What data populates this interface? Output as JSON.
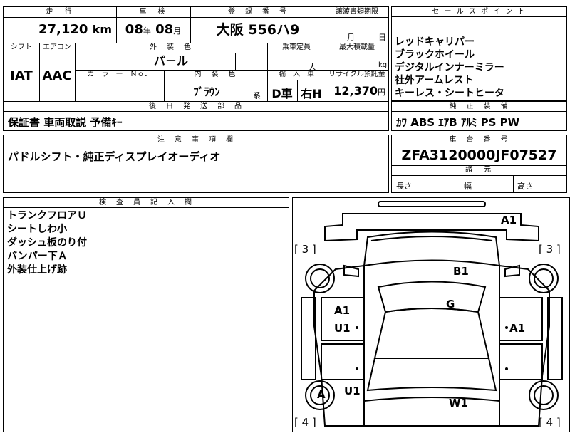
{
  "vehicle": {
    "mileage_label": "走　行",
    "mileage_value": "27,120",
    "mileage_unit": "km",
    "inspection_label": "車　検",
    "inspection_year": "08",
    "inspection_year_unit": "年",
    "inspection_month": "08",
    "inspection_month_unit": "月",
    "reg_label": "登　録　番　号",
    "reg_value": "大阪 556ハ9",
    "transfer_label": "譲渡書類期限",
    "transfer_month_unit": "月",
    "transfer_day_unit": "日",
    "shift_label": "シフト",
    "shift_value": "IAT",
    "ac_label": "エアコン",
    "ac_value": "AAC",
    "ext_color_label": "外　装　色",
    "ext_color_value": "パ－ル",
    "capacity_label": "乗車定員",
    "capacity_unit": "人",
    "max_load_label": "最大積載量",
    "max_load_unit": "kg",
    "color_no_label": "カ　ラ　ー　Ｎｏ．",
    "int_color_label": "内　装　色",
    "int_color_value": "ﾌﾞﾗｳﾝ",
    "int_color_suffix": "系",
    "import_label": "輸　入　車",
    "import_value": "D車",
    "steering_value": "右H",
    "recycle_label": "リサイクル預託金",
    "recycle_value": "12,370",
    "recycle_unit": "円"
  },
  "sales_points": {
    "header": "セ ー ル ス ポ イ ン ト",
    "items": [
      "レッドキャリパー",
      "ブラックホイール",
      "デジタルインナーミラー",
      "社外アームレスト",
      "キーレス・シートヒータ"
    ]
  },
  "standard_equipment": {
    "header": "純　正　装　備",
    "value": "ｶﾜ ABS ｴｱB ｱﾙﾐ PS PW"
  },
  "later_parts": {
    "header": "後　日　発　送　部　品",
    "value": "保証書 車両取説 予備ｷｰ"
  },
  "notes": {
    "header": "注　意　事　項　欄",
    "value": "パドルシフト・純正ディスプレイオーディオ"
  },
  "chassis": {
    "header": "車　台　番　号",
    "value": "ZFA3120000JF07527",
    "spec_header": "諸　元",
    "length_label": "長さ",
    "width_label": "幅",
    "height_label": "高さ"
  },
  "inspector": {
    "header": "検　査　員　記　入　欄",
    "items": [
      "トランクフロアＵ",
      "シートしわ小",
      "ダッシュ板のり付",
      "バンパー下Ａ",
      "外装仕上げ跡"
    ]
  },
  "diagram": {
    "marks": {
      "a1_top": "A1",
      "b1": "B1",
      "g": "G",
      "a1_left": "A1",
      "u1_left": "U1",
      "a1_right": "A1",
      "a": "A",
      "u1_lower": "U1",
      "w1": "W1"
    },
    "tire_left_top": "[ 3 ]",
    "tire_right_top": "[ 3 ]",
    "tire_left_bottom": "[ 4 ]",
    "tire_right_bottom": "[ 4 ]"
  }
}
